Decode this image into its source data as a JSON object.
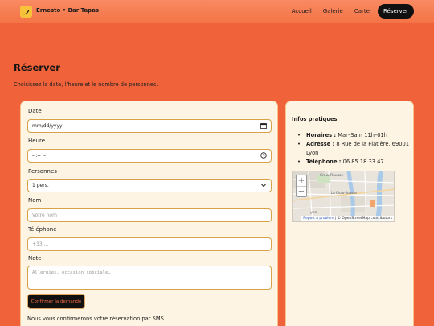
{
  "header": {
    "brand": "Ernesto • Bar Tapas",
    "nav": [
      "Accueil",
      "Galerie",
      "Carte",
      "Réserver"
    ]
  },
  "page": {
    "title": "Réserver",
    "subtitle": "Choisissez la date, l’heure et le nombre de personnes."
  },
  "form": {
    "date_label": "Date",
    "date_value": "mm/dd/yyyy",
    "time_label": "Heure",
    "time_value": "--:-- --",
    "people_label": "Personnes",
    "people_value": "1 pers.",
    "name_label": "Nom",
    "name_placeholder": "Votre nom",
    "phone_label": "Téléphone",
    "phone_placeholder": "+33 ...",
    "note_label": "Note",
    "note_placeholder": "Allergies, occasion spéciale…",
    "submit_label": "Confirmer la demande",
    "sms_note": "Nous vous confirmerons votre réservation par SMS."
  },
  "info": {
    "title": "Infos pratiques",
    "hours_label": "Horaires :",
    "hours_value": " Mar–Sam 11h–01h",
    "address_label": "Adresse :",
    "address_value": " 8 Rue de la Platière, 69001 Lyon",
    "phone_label": "Téléphone :",
    "phone_value": " 06 85 18 33 47"
  },
  "map": {
    "zoom_in": "+",
    "zoom_out": "−",
    "attr_link": "Report a problem",
    "attr_text": " | © OpenStreetMap contributors",
    "label_top": "Croix-Rousse",
    "label_mid": "La Croix-Rousse",
    "label_left": "Lyon"
  },
  "colors": {
    "page_bg": "#f0623a",
    "card_bg": "#fdf4e3",
    "accent": "#f8c23a",
    "button_bg": "#111111"
  },
  "icons": {
    "logo": "banana-icon",
    "calendar": "calendar-icon",
    "clock": "clock-icon",
    "select": "chevron-down-icon"
  }
}
